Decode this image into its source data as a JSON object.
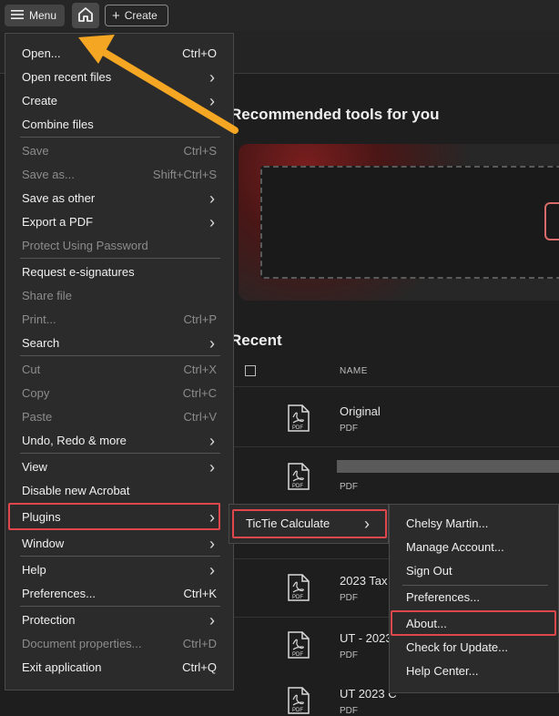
{
  "topbar": {
    "menu_label": "Menu",
    "create_label": "Create"
  },
  "main": {
    "recommended_title": "Recommended tools for you",
    "recent_title": "Recent",
    "name_header": "NAME",
    "files": [
      {
        "name": "Original",
        "type": "PDF"
      },
      {
        "name": "",
        "type": "PDF"
      },
      {
        "name": "2023 Tax",
        "type": "PDF"
      },
      {
        "name": "UT - 2023",
        "type": "PDF"
      },
      {
        "name": "UT 2023 C",
        "type": "PDF"
      }
    ]
  },
  "menu": {
    "items": [
      {
        "label": "Open...",
        "shortcut": "Ctrl+O"
      },
      {
        "label": "Open recent files",
        "submenu": true
      },
      {
        "label": "Create",
        "submenu": true
      },
      {
        "label": "Combine files"
      },
      {
        "label": "Save",
        "shortcut": "Ctrl+S",
        "disabled": true
      },
      {
        "label": "Save as...",
        "shortcut": "Shift+Ctrl+S",
        "disabled": true
      },
      {
        "label": "Save as other",
        "submenu": true
      },
      {
        "label": "Export a PDF",
        "submenu": true
      },
      {
        "label": "Protect Using Password",
        "disabled": true
      },
      {
        "label": "Request e-signatures"
      },
      {
        "label": "Share file",
        "disabled": true
      },
      {
        "label": "Print...",
        "shortcut": "Ctrl+P",
        "disabled": true
      },
      {
        "label": "Search",
        "submenu": true
      },
      {
        "label": "Cut",
        "shortcut": "Ctrl+X",
        "disabled": true
      },
      {
        "label": "Copy",
        "shortcut": "Ctrl+C",
        "disabled": true
      },
      {
        "label": "Paste",
        "shortcut": "Ctrl+V",
        "disabled": true
      },
      {
        "label": "Undo, Redo & more",
        "submenu": true
      },
      {
        "label": "View",
        "submenu": true
      },
      {
        "label": "Disable new Acrobat"
      },
      {
        "label": "Plugins",
        "submenu": true
      },
      {
        "label": "Window",
        "submenu": true
      },
      {
        "label": "Help",
        "submenu": true
      },
      {
        "label": "Preferences...",
        "shortcut": "Ctrl+K"
      },
      {
        "label": "Protection",
        "submenu": true
      },
      {
        "label": "Document properties...",
        "shortcut": "Ctrl+D",
        "disabled": true
      },
      {
        "label": "Exit application",
        "shortcut": "Ctrl+Q"
      }
    ]
  },
  "plugins_submenu": {
    "items": [
      {
        "label": "TicTie Calculate",
        "submenu": true
      }
    ]
  },
  "tictie_submenu": {
    "items": [
      {
        "label": "Chelsy Martin..."
      },
      {
        "label": "Manage Account..."
      },
      {
        "label": "Sign Out"
      },
      {
        "label": "Preferences..."
      },
      {
        "label": "About..."
      },
      {
        "label": "Check for Update..."
      },
      {
        "label": "Help Center..."
      }
    ]
  },
  "colors": {
    "highlight": "#e0474c",
    "arrow": "#f5a623",
    "pdf_icon": "#d9d9d9"
  }
}
